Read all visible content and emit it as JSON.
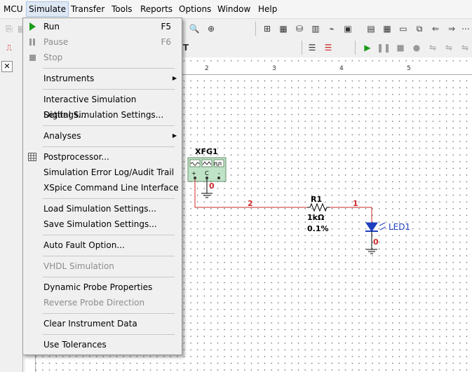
{
  "menubar": {
    "items": [
      {
        "label": "MCU"
      },
      {
        "label": "Simulate"
      },
      {
        "label": "Transfer"
      },
      {
        "label": "Tools"
      },
      {
        "label": "Reports"
      },
      {
        "label": "Options"
      },
      {
        "label": "Window"
      },
      {
        "label": "Help"
      }
    ],
    "active_index": 1
  },
  "simulate_menu": {
    "run": {
      "label": "Run",
      "shortcut": "F5"
    },
    "pause": {
      "label": "Pause",
      "shortcut": "F6"
    },
    "stop": {
      "label": "Stop"
    },
    "instruments": {
      "label": "Instruments"
    },
    "interactive_settings": {
      "label": "Interactive Simulation Settings..."
    },
    "digital_settings": {
      "label": "Digital Simulation Settings..."
    },
    "analyses": {
      "label": "Analyses"
    },
    "postprocessor": {
      "label": "Postprocessor..."
    },
    "error_log": {
      "label": "Simulation Error Log/Audit Trail"
    },
    "xspice": {
      "label": "XSpice Command Line Interface"
    },
    "load_settings": {
      "label": "Load Simulation Settings..."
    },
    "save_settings": {
      "label": "Save Simulation Settings..."
    },
    "auto_fault": {
      "label": "Auto Fault Option..."
    },
    "vhdl": {
      "label": "VHDL Simulation"
    },
    "dynamic_probe": {
      "label": "Dynamic Probe Properties"
    },
    "reverse_probe": {
      "label": "Reverse Probe Direction"
    },
    "clear_instrument": {
      "label": "Clear Instrument Data"
    },
    "use_tolerances": {
      "label": "Use Tolerances"
    }
  },
  "ruler": {
    "marks": [
      "2",
      "3",
      "4",
      "5"
    ]
  },
  "schematic": {
    "xfg_label": "XFG1",
    "xfg_pins": [
      "+",
      "C",
      "-"
    ],
    "r_label": "R1",
    "r_value": "1kΩ",
    "r_tolerance": "0.1%",
    "led_label": "LED1",
    "net_2": "2",
    "net_1": "1",
    "net_0a": "0",
    "net_0b": "0"
  },
  "colors": {
    "wire": "#cc2a2a",
    "led": "#1f3fbf",
    "menu_highlight": "#dde8f4",
    "run_green": "#1a9c1a"
  }
}
